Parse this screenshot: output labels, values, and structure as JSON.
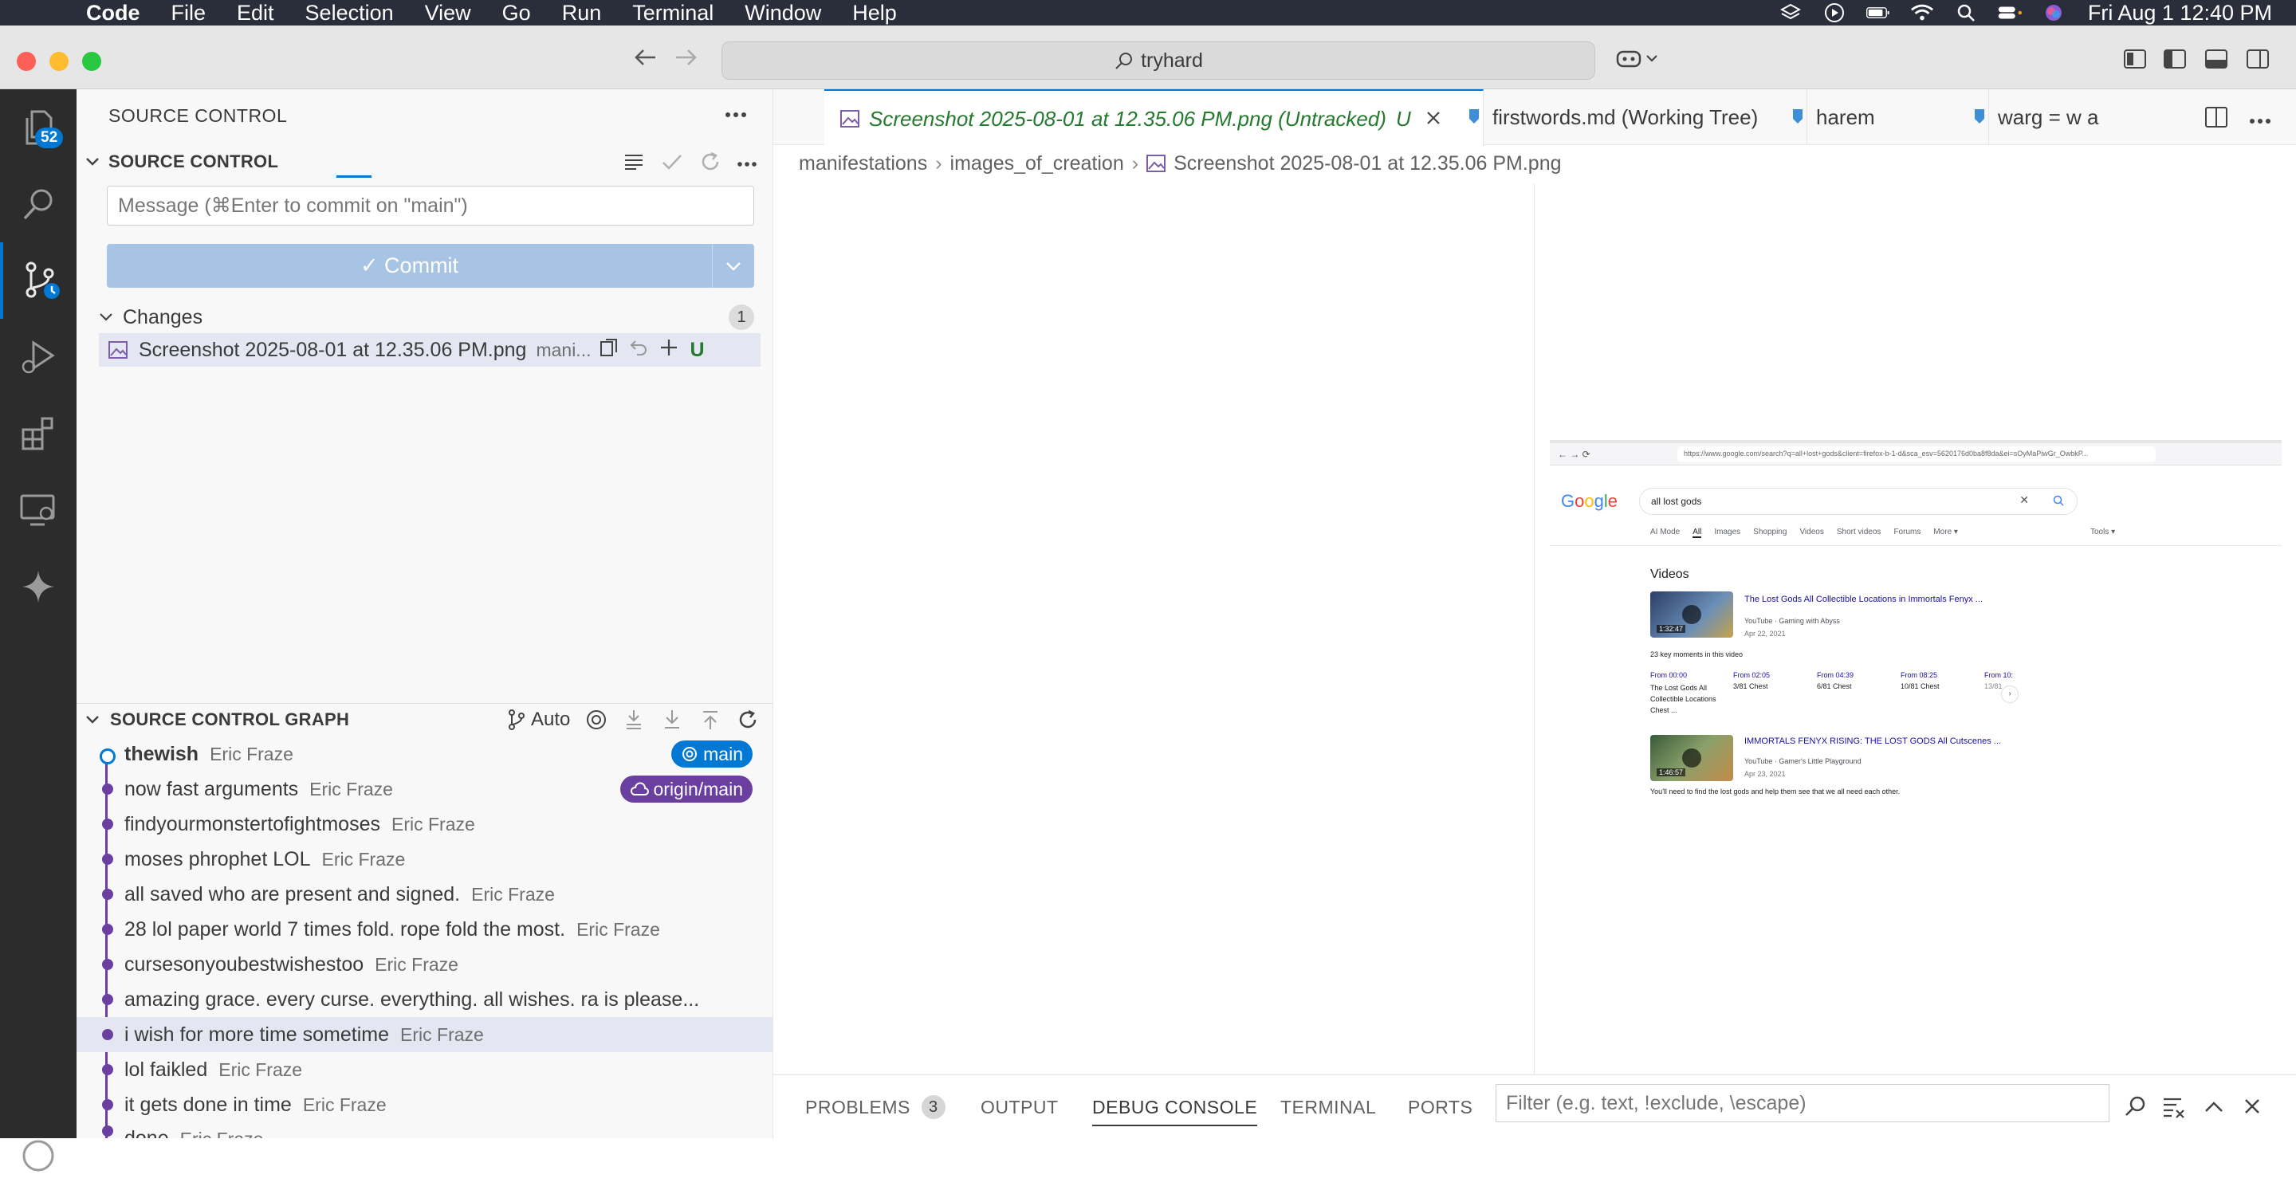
{
  "menubar": {
    "app": "Code",
    "items": [
      "File",
      "Edit",
      "Selection",
      "View",
      "Go",
      "Run",
      "Terminal",
      "Window",
      "Help"
    ],
    "clock": "Fri Aug 1  12:40 PM"
  },
  "titlebar": {
    "search": "tryhard"
  },
  "activity": {
    "badge": "52"
  },
  "sidebar": {
    "title": "SOURCE CONTROL",
    "section": "SOURCE CONTROL",
    "commit_placeholder": "Message (⌘Enter to commit on \"main\")",
    "commit_label": "✓ Commit",
    "changes_label": "Changes",
    "changes_count": "1",
    "file": {
      "name": "Screenshot 2025-08-01 at 12.35.06 PM.png",
      "desc": "mani...",
      "status": "U"
    }
  },
  "graph": {
    "title": "SOURCE CONTROL GRAPH",
    "auto_label": "Auto",
    "commits": [
      {
        "msg": "thewish",
        "author": "Eric Fraze"
      },
      {
        "msg": "now fast arguments",
        "author": "Eric Fraze"
      },
      {
        "msg": "findyourmonstertofightmoses",
        "author": "Eric Fraze"
      },
      {
        "msg": "moses phrophet LOL",
        "author": "Eric Fraze"
      },
      {
        "msg": "all saved who are present and signed.",
        "author": "Eric Fraze"
      },
      {
        "msg": "28 lol paper world 7 times fold. rope fold the most.",
        "author": "Eric Fraze"
      },
      {
        "msg": "cursesonyoubestwishestoo",
        "author": "Eric Fraze"
      },
      {
        "msg": "amazing grace. every curse. everything. all wishes. ra is please...",
        "author": ""
      },
      {
        "msg": "i wish for more time sometime",
        "author": "Eric Fraze"
      },
      {
        "msg": "lol faikled",
        "author": "Eric Fraze"
      },
      {
        "msg": "it gets done in time",
        "author": "Eric Fraze"
      },
      {
        "msg": "done",
        "author": "Eric Fraze"
      }
    ],
    "ref_main": "main",
    "ref_origin": "origin/main"
  },
  "tabs": [
    {
      "label": "Screenshot 2025-08-01 at 12.35.06 PM.png (Untracked)",
      "status": "U"
    },
    {
      "label": "firstwords.md (Working Tree)"
    },
    {
      "label": "harem"
    },
    {
      "label": "warg = w a"
    }
  ],
  "breadcrumb": [
    "manifestations",
    "images_of_creation",
    "Screenshot 2025-08-01 at 12.35.06 PM.png"
  ],
  "preview": {
    "url": "https://www.google.com/search?q=all+lost+gods&client=firefox-b-1-d&sca_esv=5620176d0ba8f8da&ei=sOyMaPiwGr_OwbkP...",
    "query": "all lost gods",
    "filters": [
      "AI Mode",
      "All",
      "Images",
      "Shopping",
      "Videos",
      "Short videos",
      "Forums",
      "More ▾"
    ],
    "tools": "Tools ▾",
    "videos_heading": "Videos",
    "video1_title": "The Lost Gods All Collectible Locations in Immortals Fenyx ...",
    "video1_source": "YouTube · Gaming with Abyss",
    "video1_date": "Apr 22, 2021",
    "video1_duration": "1:32:47",
    "key_moments": "23 key moments in this video",
    "moments": [
      {
        "time": "From 00:00",
        "text": "The Lost Gods All Collectible Locations Chest ..."
      },
      {
        "time": "From 02:05",
        "text": "3/81 Chest"
      },
      {
        "time": "From 04:39",
        "text": "6/81 Chest"
      },
      {
        "time": "From 08:25",
        "text": "10/81 Chest"
      },
      {
        "time": "From 10:",
        "text": "13/81"
      }
    ],
    "video2_title": "IMMORTALS FENYX RISING: THE LOST GODS All Cutscenes ...",
    "video2_source": "YouTube · Gamer's Little Playground",
    "video2_date": "Apr 23, 2021",
    "video2_duration": "1:46:57",
    "footer": "You'll need to find the lost gods and help them see that we all need each other."
  },
  "panel": {
    "tabs": [
      "PROBLEMS",
      "OUTPUT",
      "DEBUG CONSOLE",
      "TERMINAL",
      "PORTS"
    ],
    "problems_count": "3",
    "filter_placeholder": "Filter (e.g. text, !exclude, \\escape)"
  },
  "colors": {
    "accent": "#0078d4",
    "graph": "#6b3fa0",
    "untracked": "#257a2e"
  }
}
